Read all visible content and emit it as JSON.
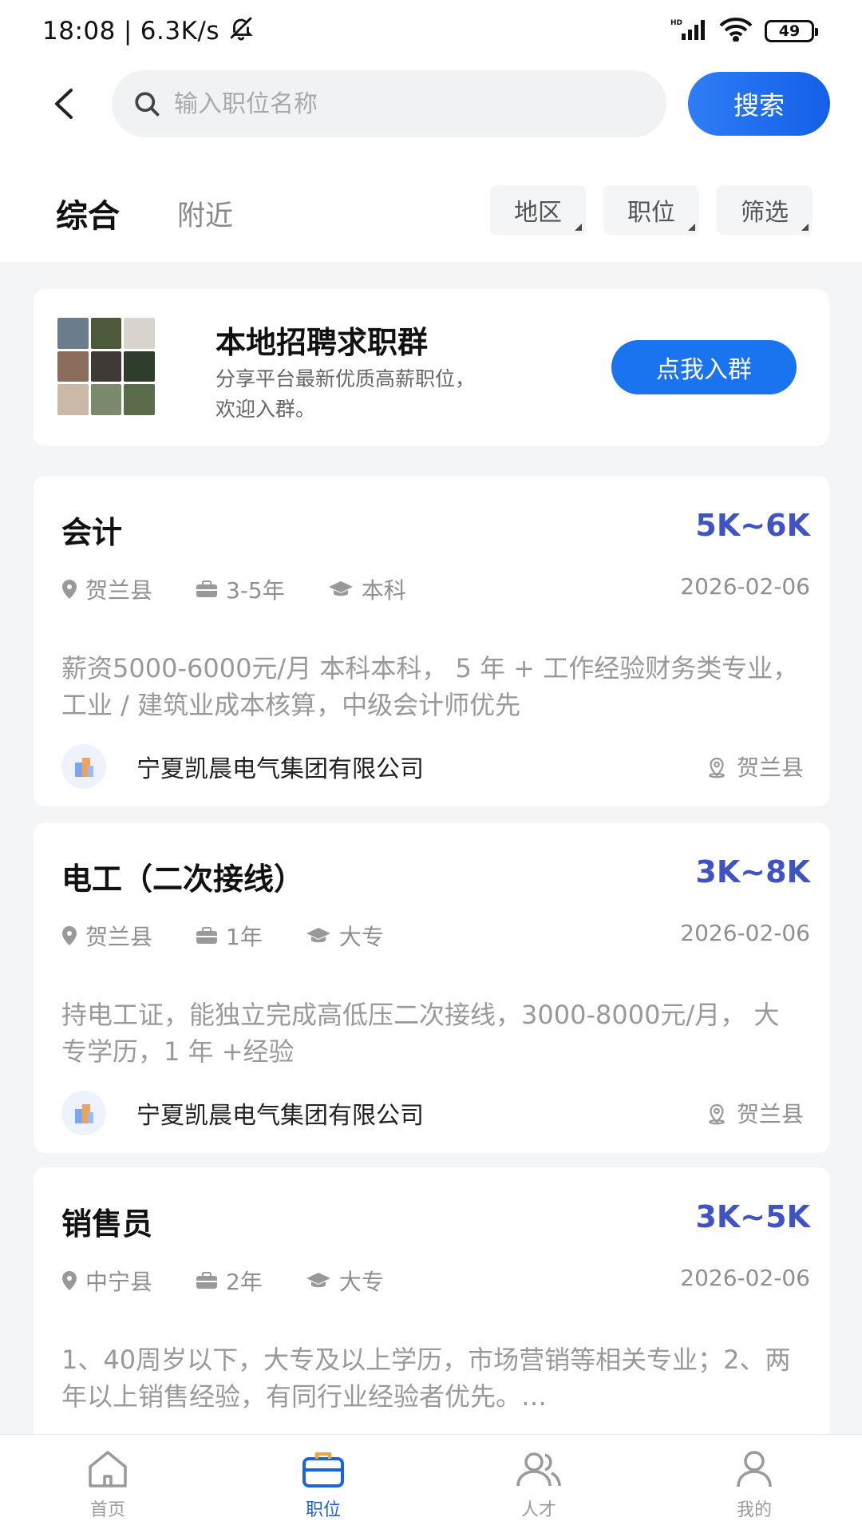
{
  "status_bar": {
    "time": "18:08",
    "net_speed": "6.3K/s",
    "battery": "49"
  },
  "search": {
    "placeholder": "输入职位名称",
    "button_label": "搜索"
  },
  "tabs": {
    "main": "综合",
    "nearby": "附近"
  },
  "filters": [
    "地区",
    "职位",
    "筛选"
  ],
  "banner": {
    "title": "本地招聘求职群",
    "desc_line1": "分享平台最新优质高薪职位，",
    "desc_line2": "欢迎入群。",
    "button_label": "点我入群"
  },
  "jobs": [
    {
      "title": "会计",
      "salary": "5K~6K",
      "location": "贺兰县",
      "experience": "3-5年",
      "education": "本科",
      "date": "2026-02-06",
      "description": "薪资5000-6000元/月 本科本科， 5 年 + 工作经验财务类专业，工业 / 建筑业成本核算，中级会计师优先",
      "company": "宁夏凯晨电气集团有限公司",
      "company_location": "贺兰县"
    },
    {
      "title": "电工（二次接线）",
      "salary": "3K~8K",
      "location": "贺兰县",
      "experience": "1年",
      "education": "大专",
      "date": "2026-02-06",
      "description": "持电工证，能独立完成高低压二次接线，3000-8000元/月， 大专学历，1 年 +经验",
      "company": "宁夏凯晨电气集团有限公司",
      "company_location": "贺兰县"
    },
    {
      "title": "销售员",
      "salary": "3K~5K",
      "location": "中宁县",
      "experience": "2年",
      "education": "大专",
      "date": "2026-02-06",
      "description": "1、40周岁以下，大专及以上学历，市场营销等相关专业；2、两年以上销售经验，有同行业经验者优先。…"
    }
  ],
  "bottom_nav": [
    {
      "label": "首页",
      "icon": "home-icon"
    },
    {
      "label": "职位",
      "icon": "briefcase-icon",
      "active": true
    },
    {
      "label": "人才",
      "icon": "people-icon"
    },
    {
      "label": "我的",
      "icon": "user-icon"
    }
  ],
  "colors": {
    "primary": "#1b74ef",
    "salary": "#3f53c2",
    "active_nav": "#1b63e0"
  }
}
